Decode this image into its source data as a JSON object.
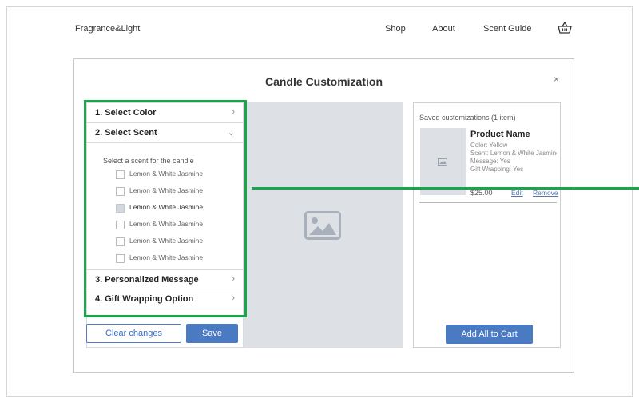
{
  "header": {
    "brand": "Fragrance&Light",
    "nav": [
      "Shop",
      "About",
      "Scent Guide"
    ],
    "cart_icon": "basket-icon"
  },
  "modal": {
    "title": "Candle Customization",
    "close_label": "×",
    "steps": [
      {
        "label": "1. Select Color",
        "chevron": ">"
      },
      {
        "label": "2. Select Scent",
        "chevron": "v"
      },
      {
        "label": "3. Personalized Message",
        "chevron": ">"
      },
      {
        "label": "4. Gift Wrapping Option",
        "chevron": ">"
      }
    ],
    "scent_hint": "Select a scent for the candle",
    "scents": [
      {
        "label": "Lemon & White Jasmine",
        "selected": false
      },
      {
        "label": "Lemon & White Jasmine",
        "selected": false
      },
      {
        "label": "Lemon & White Jasmine",
        "selected": true
      },
      {
        "label": "Lemon & White Jasmine",
        "selected": false
      },
      {
        "label": "Lemon & White Jasmine",
        "selected": false
      },
      {
        "label": "Lemon & White Jasmine",
        "selected": false
      }
    ],
    "clear_label": "Clear changes",
    "save_label": "Save",
    "preview_icon": "image-placeholder-icon",
    "saved": {
      "heading": "Saved customizations (1 item)",
      "product_name": "Product Name",
      "details": [
        "Color: Yellow",
        "Scent: Lemon & White Jasmine",
        "Message: Yes",
        "Gift Wrapping: Yes"
      ],
      "price": "$25.00",
      "edit_label": "Edit",
      "remove_label": "Remove"
    },
    "add_all_label": "Add All to Cart"
  },
  "colors": {
    "accent": "#4a7ac2",
    "highlight": "#17a64a",
    "placeholder_bg": "#dde1e6"
  }
}
